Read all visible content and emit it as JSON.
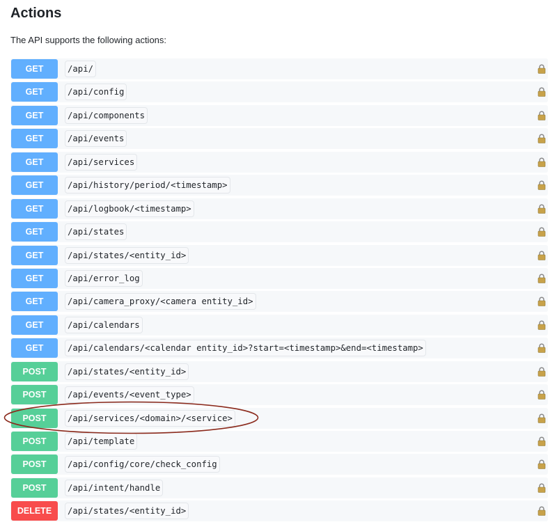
{
  "heading": "Actions",
  "intro": "The API supports the following actions:",
  "colors": {
    "get": "#61affe",
    "post": "#49cc90",
    "delete": "#f93e3e",
    "highlight_ellipse": "#8b2a1c"
  },
  "icons": {
    "lock": "lock-icon"
  },
  "highlighted_endpoint": "/api/services/<domain>/<service>",
  "endpoints": [
    {
      "method": "GET",
      "path": "/api/"
    },
    {
      "method": "GET",
      "path": "/api/config"
    },
    {
      "method": "GET",
      "path": "/api/components"
    },
    {
      "method": "GET",
      "path": "/api/events"
    },
    {
      "method": "GET",
      "path": "/api/services"
    },
    {
      "method": "GET",
      "path": "/api/history/period/<timestamp>"
    },
    {
      "method": "GET",
      "path": "/api/logbook/<timestamp>"
    },
    {
      "method": "GET",
      "path": "/api/states"
    },
    {
      "method": "GET",
      "path": "/api/states/<entity_id>"
    },
    {
      "method": "GET",
      "path": "/api/error_log"
    },
    {
      "method": "GET",
      "path": "/api/camera_proxy/<camera entity_id>"
    },
    {
      "method": "GET",
      "path": "/api/calendars"
    },
    {
      "method": "GET",
      "path": "/api/calendars/<calendar entity_id>?start=<timestamp>&end=<timestamp>"
    },
    {
      "method": "POST",
      "path": "/api/states/<entity_id>"
    },
    {
      "method": "POST",
      "path": "/api/events/<event_type>"
    },
    {
      "method": "POST",
      "path": "/api/services/<domain>/<service>"
    },
    {
      "method": "POST",
      "path": "/api/template"
    },
    {
      "method": "POST",
      "path": "/api/config/core/check_config"
    },
    {
      "method": "POST",
      "path": "/api/intent/handle"
    },
    {
      "method": "DELETE",
      "path": "/api/states/<entity_id>"
    }
  ]
}
